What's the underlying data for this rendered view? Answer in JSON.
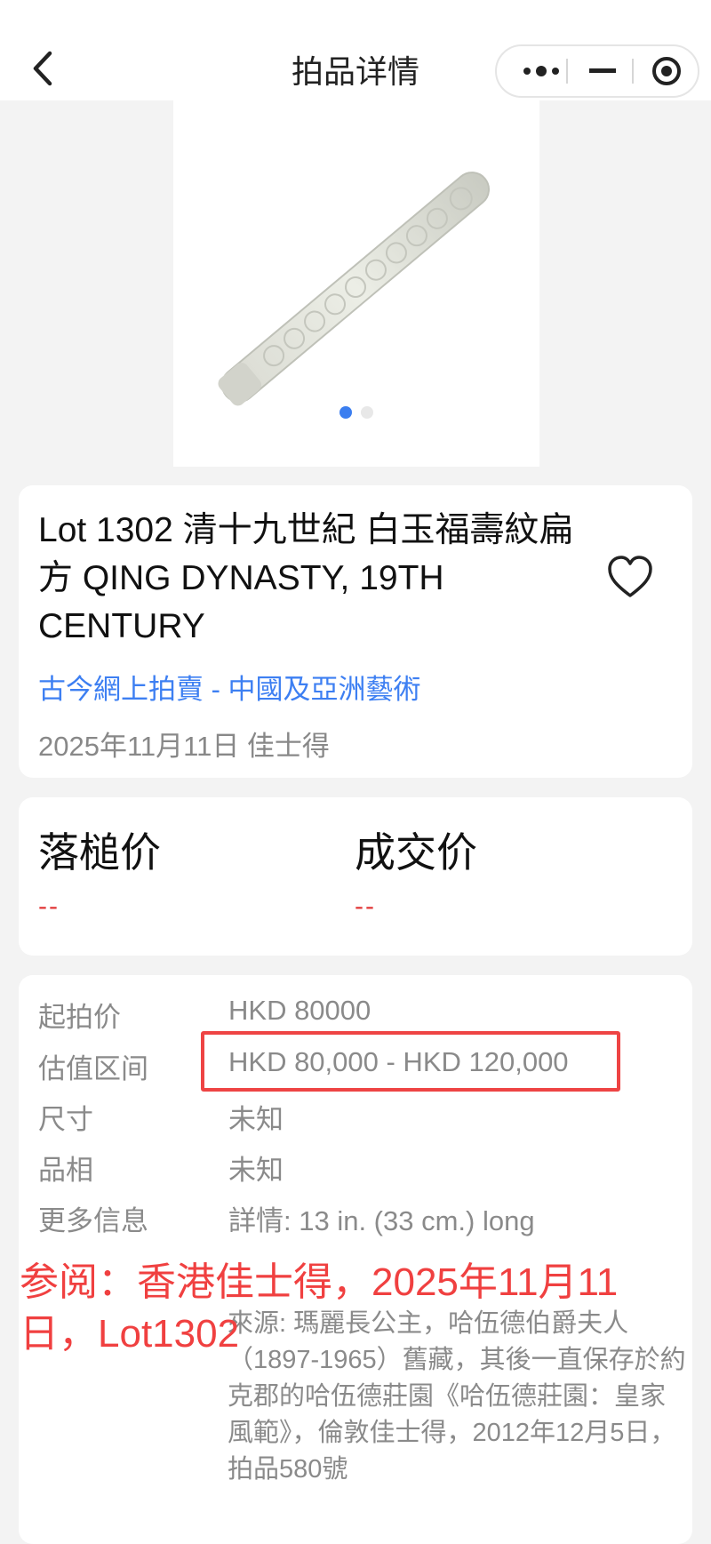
{
  "header": {
    "title": "拍品详情"
  },
  "gallery": {
    "image_alt": "白玉福壽紋扁方",
    "slides": 2,
    "active_slide": 1
  },
  "lot": {
    "title": "Lot 1302 清十九世紀 白玉福壽紋扁方 QING DYNASTY, 19TH CENTURY",
    "auction": "古今網上拍賣 - 中國及亞洲藝術",
    "date_house": "2025年11月11日 佳士得"
  },
  "prices": {
    "hammer_label": "落槌价",
    "hammer_value": "--",
    "deal_label": "成交价",
    "deal_value": "--"
  },
  "details": {
    "start_label": "起拍价",
    "start_value": "HKD 80000",
    "estimate_label": "估值区间",
    "estimate_value": "HKD 80,000 - HKD 120,000",
    "size_label": "尺寸",
    "size_value": "未知",
    "condition_label": "品相",
    "condition_value": "未知",
    "more_label": "更多信息",
    "more_value": "詳情: 13 in. (33 cm.) long",
    "provenance": "來源: 瑪麗長公主，哈伍德伯爵夫人（1897-1965）舊藏，其後一直保存於約克郡的哈伍德莊園《哈伍德莊園：皇家風範》，倫敦佳士得，2012年12月5日，拍品580號"
  },
  "annotation": {
    "text": "参阅：香港佳士得，2025年11月11日，Lot1302"
  },
  "colors": {
    "accent": "#3d7ff2",
    "price": "#e23b3b",
    "annotation": "#f04040"
  }
}
